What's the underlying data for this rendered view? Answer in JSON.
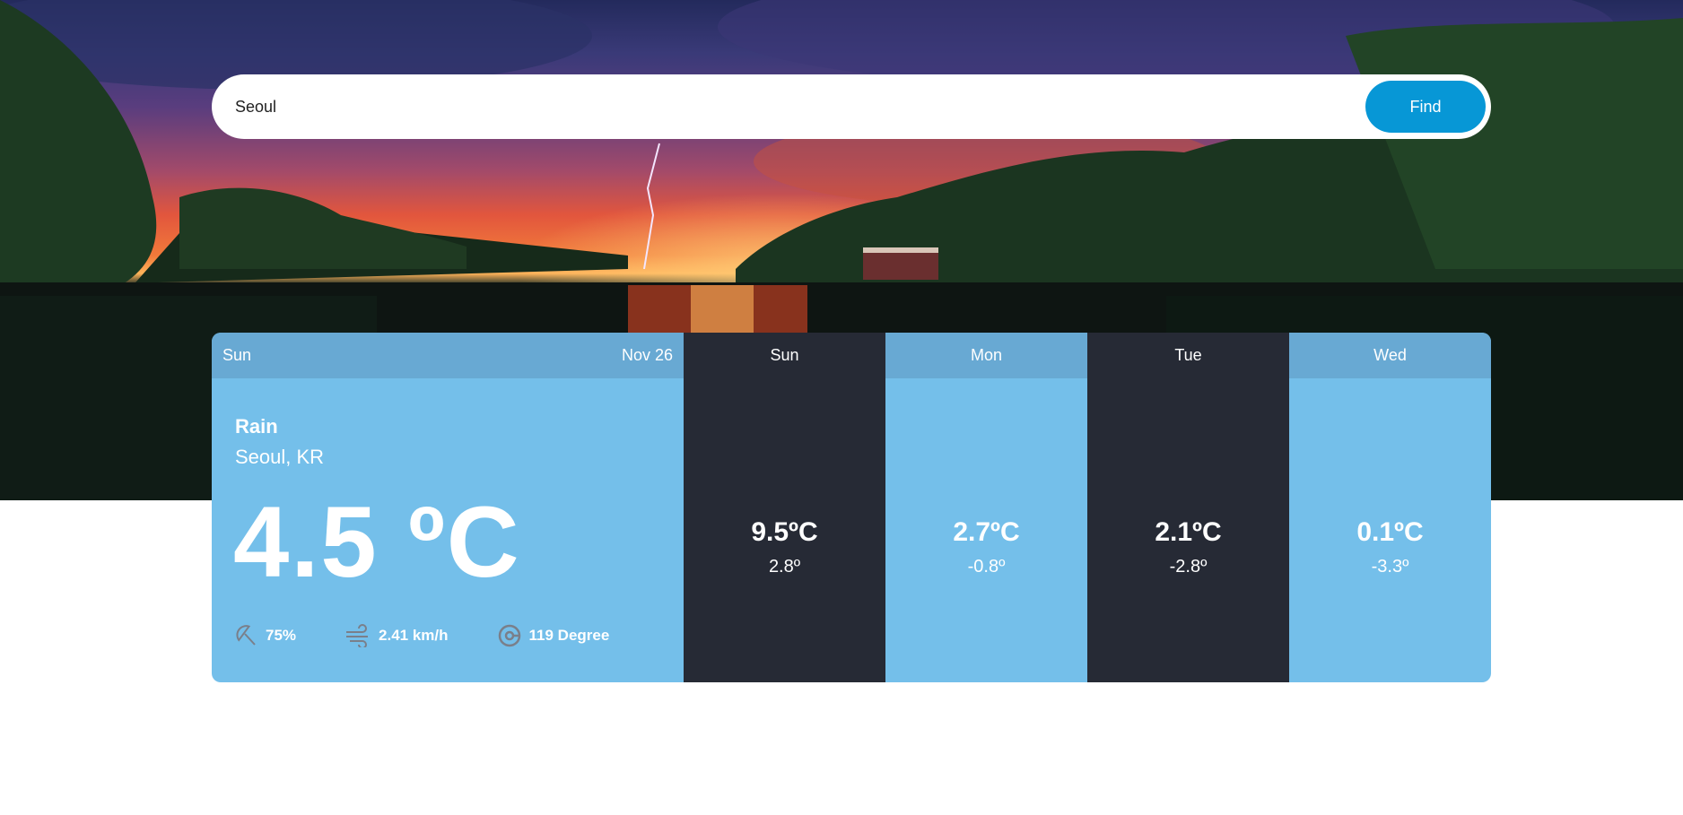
{
  "search": {
    "value": "Seoul",
    "button_label": "Find"
  },
  "current": {
    "day": "Sun",
    "date": "Nov 26",
    "condition": "Rain",
    "location": "Seoul, KR",
    "temperature": "4.5 ºC",
    "humidity": "75%",
    "wind": "2.41 km/h",
    "direction": "119 Degree",
    "icons": [
      "umbrella-icon",
      "wind-icon",
      "compass-icon"
    ]
  },
  "forecast": [
    {
      "day": "Sun",
      "high": "9.5ºC",
      "low": "2.8º",
      "theme": "dark"
    },
    {
      "day": "Mon",
      "high": "2.7ºC",
      "low": "-0.8º",
      "theme": "light"
    },
    {
      "day": "Tue",
      "high": "2.1ºC",
      "low": "-2.8º",
      "theme": "dark"
    },
    {
      "day": "Wed",
      "high": "0.1ºC",
      "low": "-3.3º",
      "theme": "light"
    }
  ],
  "colors": {
    "accent": "#0797d6",
    "card_light": "#74bfea",
    "card_header": "#68a9d3",
    "card_dark": "#262a35"
  }
}
